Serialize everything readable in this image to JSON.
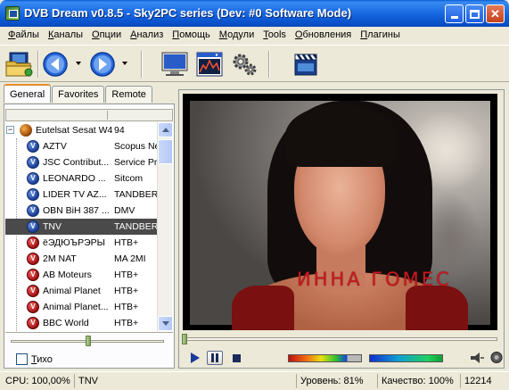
{
  "window": {
    "title": "DVB Dream v0.8.5 - Sky2PC series (Dev: #0 Software Mode)"
  },
  "menu": [
    {
      "label": "Файлы",
      "accel": "Ф",
      "rest": "айлы"
    },
    {
      "label": "Каналы",
      "accel": "К",
      "rest": "аналы"
    },
    {
      "label": "Опции",
      "accel": "О",
      "rest": "пции"
    },
    {
      "label": "Анализ",
      "accel": "А",
      "rest": "нализ"
    },
    {
      "label": "Помощь",
      "accel": "П",
      "rest": "омощь"
    },
    {
      "label": "Модули",
      "accel": "М",
      "rest": "одули"
    },
    {
      "label": "Tools",
      "accel": "T",
      "rest": "ools"
    },
    {
      "label": "Обновления",
      "accel": "О",
      "rest": "бновления"
    },
    {
      "label": "Плагины",
      "accel": "П",
      "rest": "лагины"
    }
  ],
  "toolbar": {
    "icons": [
      "open-folder-icon",
      "back-icon",
      "forward-icon",
      "monitor-icon",
      "spectrum-window-icon",
      "settings-gears-icon",
      "clapperboard-icon"
    ]
  },
  "tabs": [
    "General",
    "Favorites",
    "Remote"
  ],
  "active_tab": "General",
  "tree": {
    "satellite": {
      "name": "Eutelsat Sesat W4",
      "value": "94"
    },
    "channels": [
      {
        "name": "AZTV",
        "encoder": "Scopus Net",
        "icon": "blue"
      },
      {
        "name": "JSC Contribut...",
        "encoder": "Service Pro",
        "icon": "blue"
      },
      {
        "name": "LEONARDO ...",
        "encoder": "Sitcom",
        "icon": "blue"
      },
      {
        "name": "LIDER TV AZ...",
        "encoder": "TANDBERG",
        "icon": "blue"
      },
      {
        "name": "OBN BiH 387 ...",
        "encoder": "DMV",
        "icon": "blue"
      },
      {
        "name": "TNV",
        "encoder": "TANDBERG",
        "icon": "blue",
        "selected": true
      },
      {
        "name": "ёЭДЮЪРЭРЫ",
        "encoder": "HTB+",
        "icon": "red"
      },
      {
        "name": "2M NAT",
        "encoder": "MA 2MI",
        "icon": "red"
      },
      {
        "name": "AB Moteurs",
        "encoder": "HTB+",
        "icon": "red"
      },
      {
        "name": "Animal Planet",
        "encoder": "HTB+",
        "icon": "red"
      },
      {
        "name": "Animal Planet...",
        "encoder": "HTB+",
        "icon": "red"
      },
      {
        "name": "BBC World",
        "encoder": "HTB+",
        "icon": "red"
      }
    ]
  },
  "quiet_checkbox": {
    "accel": "Т",
    "rest": "ихо",
    "checked": false
  },
  "video": {
    "caption": "ИННА ГОМЕС"
  },
  "signal": {
    "strength_percent": 81,
    "quality_percent": 100
  },
  "status": {
    "cpu": "CPU: 100,00%",
    "channel": "TNV",
    "level": "Уровень: 81%",
    "quality": "Качество: 100%",
    "code": "12214"
  },
  "colors": {
    "titlebar": "#0b54d0",
    "selection": "#4a4a4a",
    "caption_red": "#c8191f"
  }
}
